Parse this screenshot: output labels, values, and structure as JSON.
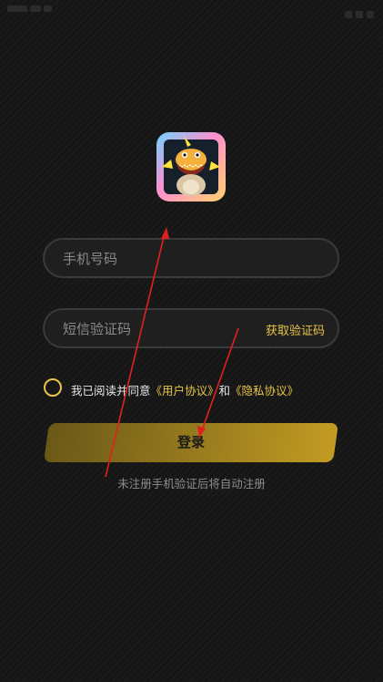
{
  "app": {
    "icon": "dinosaur-mascot-app-icon"
  },
  "form": {
    "phone_placeholder": "手机号码",
    "code_placeholder": "短信验证码",
    "get_code_label": "获取验证码"
  },
  "agreement": {
    "prefix": "我已阅读并同意",
    "user_agreement": "《用户协议》",
    "and": "和",
    "privacy_agreement": "《隐私协议》",
    "checked": false
  },
  "login_button_label": "登录",
  "tip": "未注册手机验证后将自动注册",
  "colors": {
    "accent": "#e8c547",
    "annotation": "#e02020",
    "background": "#161616"
  }
}
